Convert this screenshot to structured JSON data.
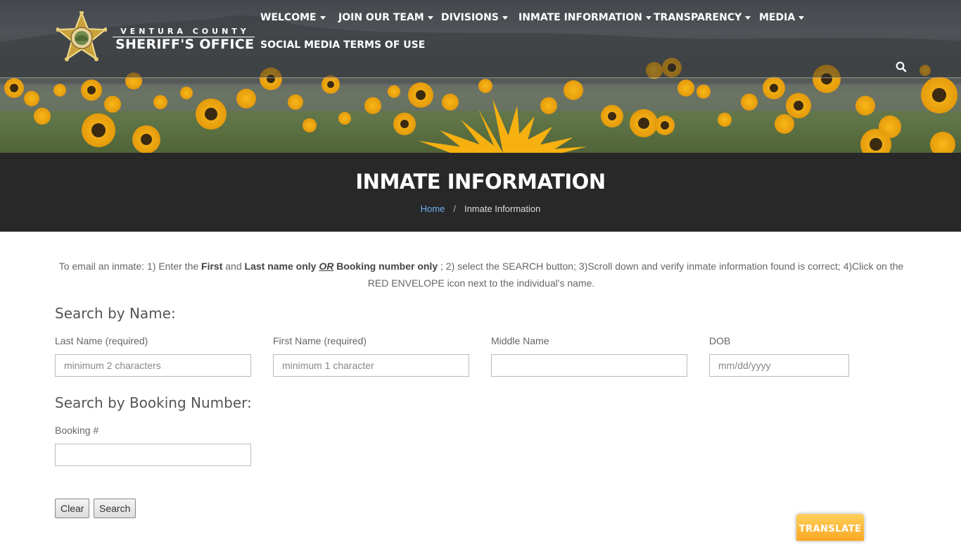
{
  "header": {
    "logo_line1": "VENTURA COUNTY",
    "logo_line2": "SHERIFF'S OFFICE",
    "nav": [
      {
        "label": "WELCOME",
        "dropdown": true
      },
      {
        "label": "JOIN OUR TEAM",
        "dropdown": true
      },
      {
        "label": "DIVISIONS",
        "dropdown": true
      },
      {
        "label": "INMATE INFORMATION",
        "dropdown": true
      },
      {
        "label": "TRANSPARENCY",
        "dropdown": true
      },
      {
        "label": "MEDIA",
        "dropdown": true
      },
      {
        "label": "SOCIAL MEDIA TERMS OF USE",
        "dropdown": false
      }
    ],
    "search_icon": "search-icon"
  },
  "page": {
    "title": "INMATE INFORMATION",
    "breadcrumb": {
      "home": "Home",
      "separator": "/",
      "current": "Inmate Information"
    }
  },
  "intro": {
    "p1": "To email an inmate: 1) Enter the ",
    "b1": "First",
    "p2": " and ",
    "b2": "Last name only",
    "p3": " ",
    "or": "OR",
    "p4": " ",
    "b3": "Booking number only",
    "p5": " ; 2) select the SEARCH button;  3)Scroll down and verify inmate information found is correct; 4)Click on the RED ENVELOPE icon next to the individual's name."
  },
  "search_by_name": {
    "title": "Search by Name:",
    "fields": {
      "last_name": {
        "label": "Last Name (required)",
        "placeholder": "minimum 2 characters"
      },
      "first_name": {
        "label": "First Name (required)",
        "placeholder": "minimum 1 character"
      },
      "middle_name": {
        "label": "Middle Name",
        "placeholder": ""
      },
      "dob": {
        "label": "DOB",
        "placeholder": "mm/dd/yyyy"
      }
    }
  },
  "search_by_booking": {
    "title": "Search by Booking Number:",
    "booking": {
      "label": "Booking #",
      "placeholder": ""
    }
  },
  "buttons": {
    "clear": "Clear",
    "search": "Search"
  },
  "translate": "TRANSLATE",
  "colors": {
    "band": "#282828",
    "link": "#6fb0f0",
    "translate": "#f9a825"
  }
}
